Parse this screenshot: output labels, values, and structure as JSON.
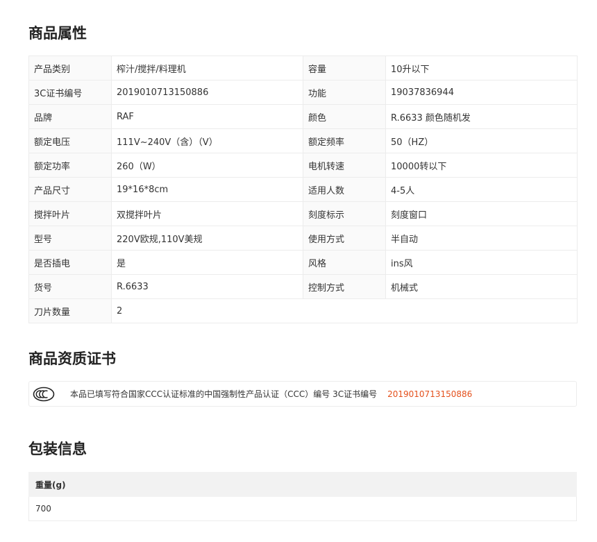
{
  "attributes_section": {
    "title": "商品属性",
    "rows": [
      [
        {
          "key": "产品类别",
          "value": "榨汁/搅拌/料理机"
        },
        {
          "key": "容量",
          "value": "10升以下"
        }
      ],
      [
        {
          "key": "3C证书编号",
          "value": "2019010713150886"
        },
        {
          "key": "功能",
          "value": "19037836944"
        }
      ],
      [
        {
          "key": "品牌",
          "value": "RAF"
        },
        {
          "key": "颜色",
          "value": "R.6633 颜色随机发"
        }
      ],
      [
        {
          "key": "额定电压",
          "value": "111V~240V（含）（V）"
        },
        {
          "key": "额定频率",
          "value": "50（HZ）"
        }
      ],
      [
        {
          "key": "额定功率",
          "value": "260（W）"
        },
        {
          "key": "电机转速",
          "value": "10000转以下"
        }
      ],
      [
        {
          "key": "产品尺寸",
          "value": "19*16*8cm"
        },
        {
          "key": "适用人数",
          "value": "4-5人"
        }
      ],
      [
        {
          "key": "搅拌叶片",
          "value": "双搅拌叶片"
        },
        {
          "key": "刻度标示",
          "value": "刻度窗口"
        }
      ],
      [
        {
          "key": "型号",
          "value": "220V欧规,110V美规"
        },
        {
          "key": "使用方式",
          "value": "半自动"
        }
      ],
      [
        {
          "key": "是否插电",
          "value": "是"
        },
        {
          "key": "风格",
          "value": "ins风"
        }
      ],
      [
        {
          "key": "货号",
          "value": "R.6633"
        },
        {
          "key": "控制方式",
          "value": "机械式"
        }
      ]
    ],
    "last_row": {
      "key": "刀片数量",
      "value": "2"
    }
  },
  "certificate_section": {
    "title": "商品资质证书",
    "logo_icon": "ccc-logo-icon",
    "text": "本品已填写符合国家CCC认证标准的中国强制性产品认证（CCC）编号 3C证书编号",
    "number": "2019010713150886",
    "number_color": "#e4501c"
  },
  "package_section": {
    "title": "包装信息",
    "header": "重量(g)",
    "value": "700"
  }
}
